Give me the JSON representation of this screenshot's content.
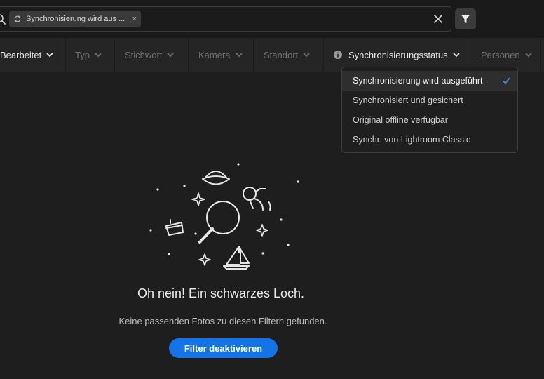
{
  "search": {
    "chip_label": "Synchronisierung wird aus ...",
    "chip_remove": "×"
  },
  "filters": [
    {
      "label": "Bearbeitet",
      "active": true
    },
    {
      "label": "Typ",
      "active": false
    },
    {
      "label": "Stichwort",
      "active": false
    },
    {
      "label": "Kamera",
      "active": false
    },
    {
      "label": "Standort",
      "active": false
    },
    {
      "label": "Synchronisierungsstatus",
      "active": true
    },
    {
      "label": "Personen",
      "active": false
    }
  ],
  "dropdown": {
    "items": [
      {
        "label": "Synchronisierung wird ausgeführt",
        "selected": true
      },
      {
        "label": "Synchronisiert und gesichert",
        "selected": false
      },
      {
        "label": "Original offline verfügbar",
        "selected": false
      },
      {
        "label": "Synchr. von Lightroom Classic",
        "selected": false
      }
    ]
  },
  "empty_state": {
    "title": "Oh nein! Ein schwarzes Loch.",
    "subtitle": "Keine passenden Fotos zu diesen Filtern gefunden.",
    "button": "Filter deaktivieren"
  },
  "colors": {
    "accent": "#1473e6",
    "check": "#4a8ff0",
    "background": "#1e1e1e"
  }
}
